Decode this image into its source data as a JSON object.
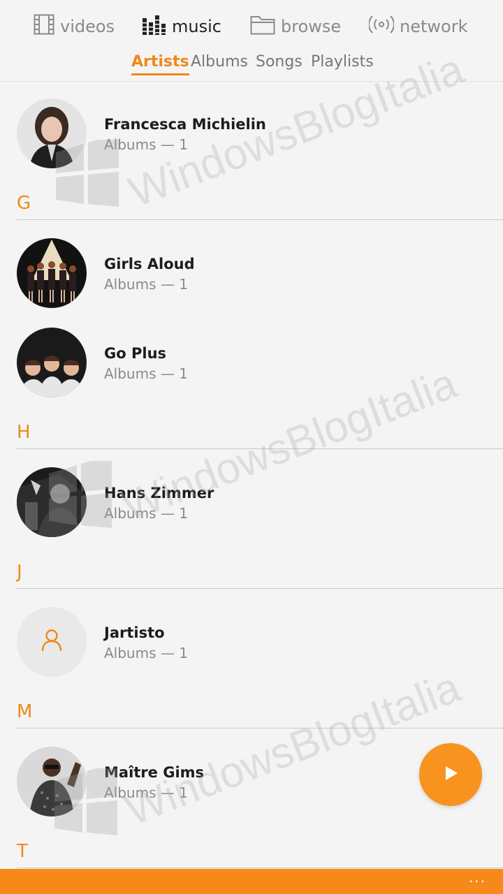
{
  "nav": {
    "videos": "videos",
    "music": "music",
    "browse": "browse",
    "network": "network"
  },
  "tabs": {
    "artists": "Artists",
    "albums": "Albums",
    "songs": "Songs",
    "playlists": "Playlists"
  },
  "artists": [
    {
      "name": "Francesca Michielin",
      "meta": "Albums — 1"
    },
    {
      "name": "Girls Aloud",
      "meta": "Albums — 1"
    },
    {
      "name": "Go Plus",
      "meta": "Albums — 1"
    },
    {
      "name": "Hans Zimmer",
      "meta": "Albums — 1"
    },
    {
      "name": "Jartisto",
      "meta": "Albums — 1"
    },
    {
      "name": "Maître Gims",
      "meta": "Albums — 1"
    }
  ],
  "letters": {
    "g": "G",
    "h": "H",
    "j": "J",
    "m": "M",
    "t": "T"
  },
  "bottom": {
    "more": "···"
  },
  "watermark": {
    "text": "WindowsBlogItalia"
  },
  "colors": {
    "accent": "#f0881a",
    "background": "#f4f4f4"
  }
}
